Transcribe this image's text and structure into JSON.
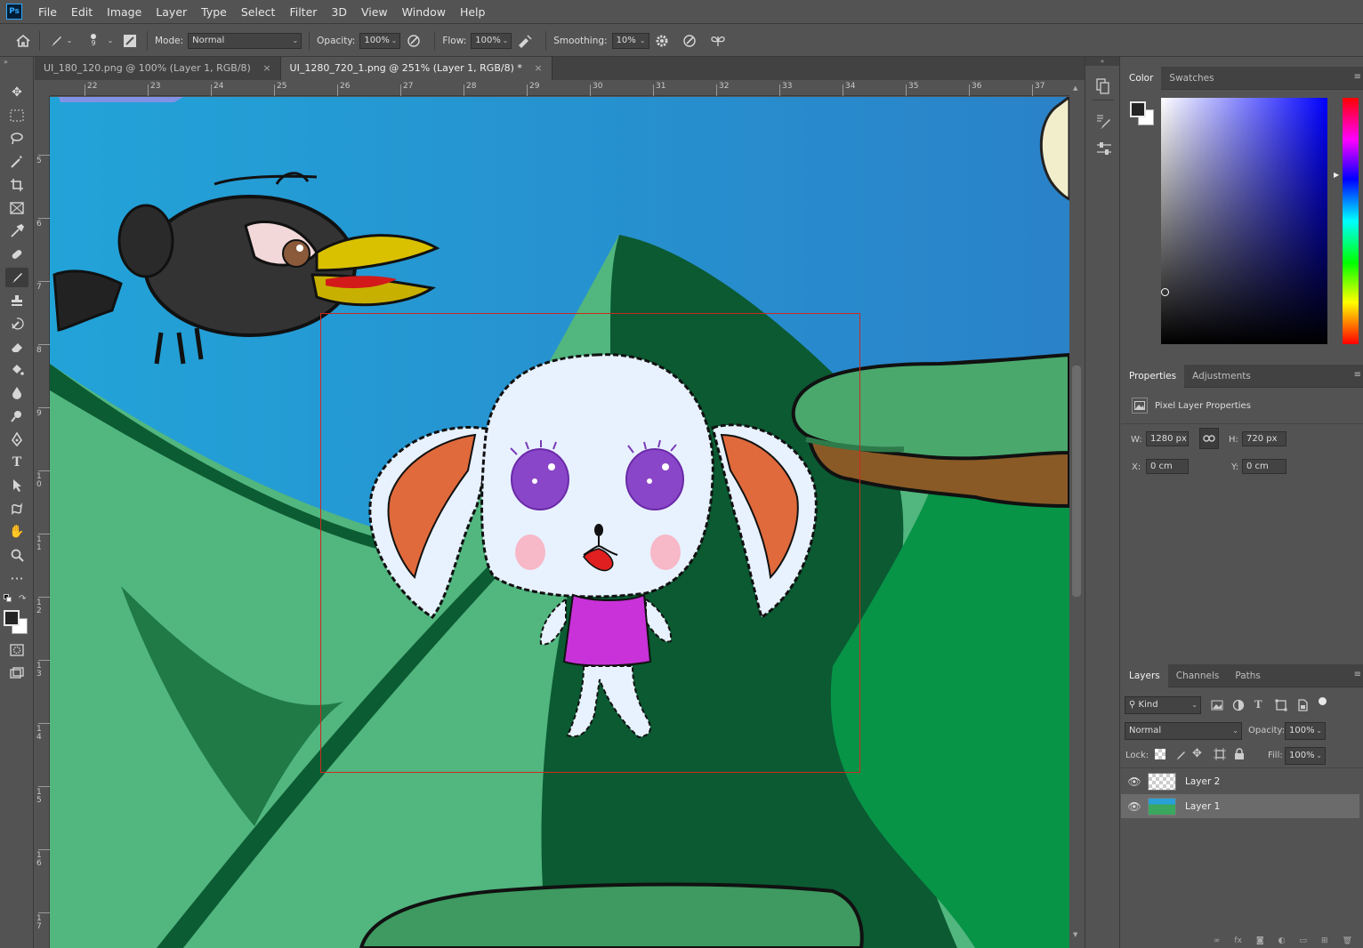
{
  "app": {
    "logo": "Ps"
  },
  "menu": [
    "File",
    "Edit",
    "Image",
    "Layer",
    "Type",
    "Select",
    "Filter",
    "3D",
    "View",
    "Window",
    "Help"
  ],
  "options": {
    "brush_size": "9",
    "mode_label": "Mode:",
    "mode_value": "Normal",
    "opacity_label": "Opacity:",
    "opacity_value": "100%",
    "flow_label": "Flow:",
    "flow_value": "100%",
    "smoothing_label": "Smoothing:",
    "smoothing_value": "10%"
  },
  "tabs": [
    {
      "label": "UI_180_120.png @ 100% (Layer 1, RGB/8)",
      "close": "×"
    },
    {
      "label": "UI_1280_720_1.png @ 251% (Layer 1, RGB/8) *",
      "close": "×"
    }
  ],
  "ruler": {
    "top": [
      "22",
      "23",
      "24",
      "25",
      "26",
      "27",
      "28",
      "29",
      "30",
      "31",
      "32",
      "33",
      "34",
      "35",
      "36",
      "37"
    ],
    "left": [
      "5",
      "6",
      "7",
      "8",
      "9",
      "10",
      "11",
      "12",
      "13",
      "14",
      "15",
      "16",
      "17"
    ]
  },
  "color_panel": {
    "tab_color": "Color",
    "tab_swatches": "Swatches"
  },
  "properties_panel": {
    "tab_properties": "Properties",
    "tab_adjustments": "Adjustments",
    "title": "Pixel Layer Properties",
    "w_label": "W:",
    "w_value": "1280 px",
    "h_label": "H:",
    "h_value": "720 px",
    "x_label": "X:",
    "x_value": "0 cm",
    "y_label": "Y:",
    "y_value": "0 cm"
  },
  "layers_panel": {
    "tab_layers": "Layers",
    "tab_channels": "Channels",
    "tab_paths": "Paths",
    "filter_kind": "Kind",
    "blend_mode": "Normal",
    "opacity_label": "Opacity:",
    "opacity_value": "100%",
    "lock_label": "Lock:",
    "fill_label": "Fill:",
    "fill_value": "100%",
    "layers": [
      {
        "name": "Layer 2"
      },
      {
        "name": "Layer 1"
      }
    ]
  },
  "colors": {
    "sky": "#1f96d4",
    "hill_light": "#4fb57e",
    "hill_dark": "#0b5a32",
    "hill_green": "#079447",
    "bunny_white": "#e8f2ff",
    "ear_orange": "#e06a3b",
    "shirt": "#c832d8",
    "selection_box": "#cc2a1f"
  }
}
